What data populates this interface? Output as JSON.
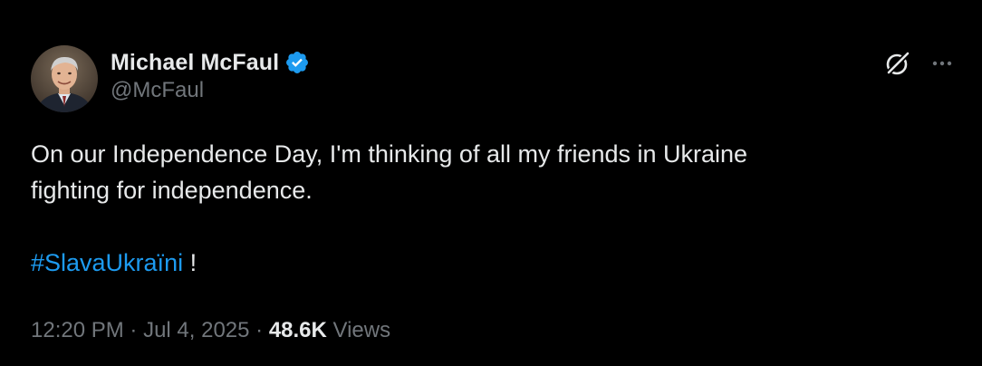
{
  "author": {
    "display_name": "Michael McFaul",
    "handle": "@McFaul",
    "verified_icon": "verified-badge-icon",
    "avatar": "avatar"
  },
  "header_actions": {
    "grok_icon": "grok-icon",
    "more_icon": "more-options-icon"
  },
  "tweet": {
    "line1": "On our Independence Day, I'm thinking of all my friends in Ukraine",
    "line2": "fighting for independence.",
    "hashtag": "#SlavaUkraïni",
    "hashtag_suffix": " !"
  },
  "meta": {
    "time": "12:20 PM",
    "separator": " · ",
    "date": "Jul 4, 2025",
    "views_count": "48.6K",
    "views_label": " Views"
  },
  "colors": {
    "background": "#000000",
    "text": "#e7e9ea",
    "muted": "#71767b",
    "accent": "#1d9bf0"
  }
}
